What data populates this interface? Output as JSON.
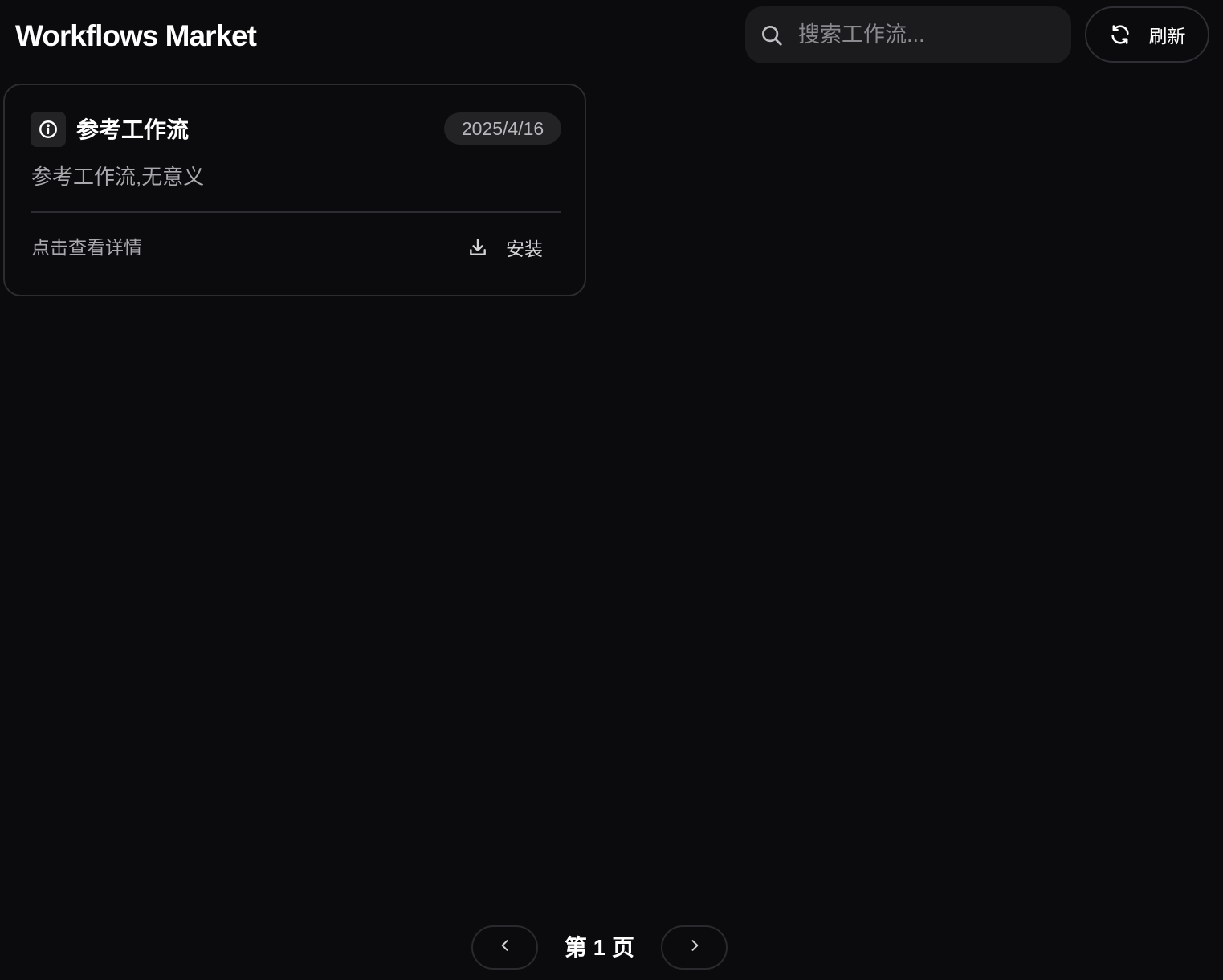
{
  "header": {
    "title": "Workflows Market"
  },
  "search": {
    "placeholder": "搜索工作流...",
    "value": ""
  },
  "toolbar": {
    "refresh_label": "刷新"
  },
  "workflows": [
    {
      "title": "参考工作流",
      "date": "2025/4/16",
      "description": "参考工作流,无意义",
      "details_label": "点击查看详情",
      "install_label": "安装",
      "icon": "info-icon"
    }
  ],
  "pagination": {
    "label": "第 1 页",
    "current_page": 1
  },
  "colors": {
    "background": "#0b0b0d",
    "surface": "#1b1b1e",
    "border": "#2d2d31",
    "text_primary": "#ffffff",
    "text_secondary": "#a9a9ae"
  }
}
